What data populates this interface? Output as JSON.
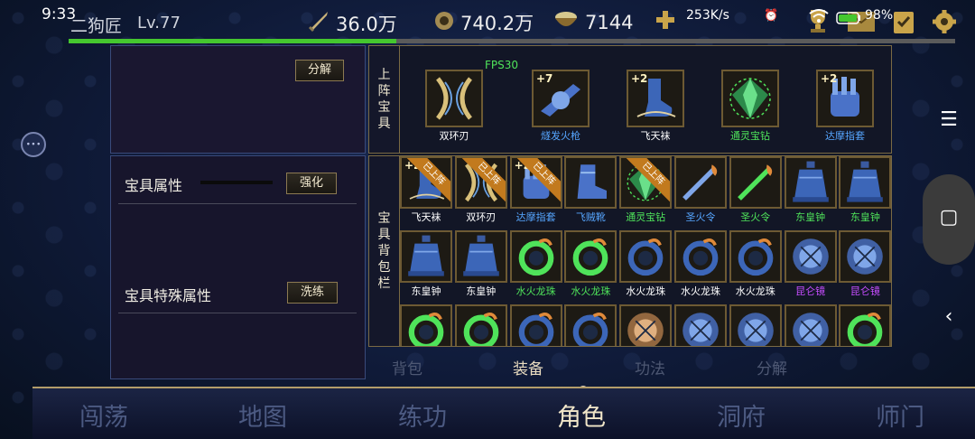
{
  "status": {
    "time": "9:33",
    "network_speed": "253K/s",
    "battery": "98%"
  },
  "player": {
    "name": "二狗匠",
    "level": "Lv.77",
    "xp_fraction": 0.37
  },
  "resources": {
    "power": "36.0万",
    "coins": "740.2万",
    "food": "7144"
  },
  "fps": "FPS30",
  "left": {
    "decompose_btn": "分解",
    "treasure_attr_label": "宝具属性",
    "enhance_btn": "强化",
    "special_attr_label": "宝具特殊属性",
    "refine_btn": "洗练"
  },
  "equipped": {
    "label_chars": [
      "上",
      "阵",
      "宝",
      "具"
    ],
    "items": [
      {
        "name": "双环刃",
        "plus": "",
        "color": "white",
        "icon": "double-ring-blade-icon"
      },
      {
        "name": "燧发火枪",
        "plus": "+7",
        "color": "blue",
        "icon": "flintlock-gun-icon"
      },
      {
        "name": "飞天袜",
        "plus": "+2",
        "color": "white",
        "icon": "flying-sock-icon"
      },
      {
        "name": "通灵宝钻",
        "plus": "",
        "color": "green",
        "icon": "spirit-diamond-icon"
      },
      {
        "name": "达摩指套",
        "plus": "+2",
        "color": "blue",
        "icon": "dharma-finger-icon"
      }
    ]
  },
  "bag": {
    "label_chars": [
      "宝",
      "具",
      "背",
      "包",
      "栏"
    ],
    "equipped_tag": "已上阵",
    "rows": [
      [
        {
          "name": "飞天袜",
          "plus": "+2",
          "tag": true,
          "color": "white",
          "icon": "flying-sock-icon"
        },
        {
          "name": "双环刃",
          "plus": "",
          "tag": true,
          "color": "white",
          "icon": "double-ring-blade-icon"
        },
        {
          "name": "达摩指套",
          "plus": "+2",
          "tag": true,
          "color": "blue",
          "icon": "dharma-finger-icon"
        },
        {
          "name": "飞贼靴",
          "plus": "",
          "tag": false,
          "color": "blue",
          "icon": "thief-boots-icon"
        },
        {
          "name": "通灵宝钻",
          "plus": "",
          "tag": true,
          "color": "green",
          "icon": "spirit-diamond-icon"
        },
        {
          "name": "圣火令",
          "plus": "",
          "tag": false,
          "color": "blue",
          "icon": "holy-fire-token-icon"
        },
        {
          "name": "圣火令",
          "plus": "",
          "tag": false,
          "color": "green",
          "icon": "holy-fire-token-icon"
        },
        {
          "name": "东皇钟",
          "plus": "",
          "tag": false,
          "color": "green",
          "icon": "bell-icon"
        },
        {
          "name": "东皇钟",
          "plus": "",
          "tag": false,
          "color": "green",
          "icon": "bell-icon"
        }
      ],
      [
        {
          "name": "东皇钟",
          "plus": "",
          "tag": false,
          "color": "white",
          "icon": "bell-icon"
        },
        {
          "name": "东皇钟",
          "plus": "",
          "tag": false,
          "color": "white",
          "icon": "bell-icon"
        },
        {
          "name": "水火龙珠",
          "plus": "",
          "tag": false,
          "color": "green",
          "icon": "dragon-pearl-icon"
        },
        {
          "name": "水火龙珠",
          "plus": "",
          "tag": false,
          "color": "green",
          "icon": "dragon-pearl-icon"
        },
        {
          "name": "水火龙珠",
          "plus": "",
          "tag": false,
          "color": "white",
          "icon": "dragon-pearl-icon"
        },
        {
          "name": "水火龙珠",
          "plus": "",
          "tag": false,
          "color": "white",
          "icon": "dragon-pearl-icon"
        },
        {
          "name": "水火龙珠",
          "plus": "",
          "tag": false,
          "color": "white",
          "icon": "dragon-pearl-icon"
        },
        {
          "name": "昆仑镜",
          "plus": "",
          "tag": false,
          "color": "purple",
          "icon": "kunlun-mirror-icon"
        },
        {
          "name": "昆仑镜",
          "plus": "",
          "tag": false,
          "color": "purple",
          "icon": "kunlun-mirror-icon"
        }
      ],
      [
        {
          "name": "",
          "plus": "",
          "tag": false,
          "color": "green",
          "icon": "dragon-pearl-icon"
        },
        {
          "name": "",
          "plus": "",
          "tag": false,
          "color": "green",
          "icon": "dragon-pearl-icon"
        },
        {
          "name": "",
          "plus": "",
          "tag": false,
          "color": "blue",
          "icon": "dragon-pearl-icon"
        },
        {
          "name": "",
          "plus": "",
          "tag": false,
          "color": "blue",
          "icon": "dragon-pearl-icon"
        },
        {
          "name": "",
          "plus": "",
          "tag": false,
          "color": "orange",
          "icon": "kunlun-mirror-icon"
        },
        {
          "name": "",
          "plus": "",
          "tag": false,
          "color": "blue",
          "icon": "kunlun-mirror-icon"
        },
        {
          "name": "",
          "plus": "",
          "tag": false,
          "color": "blue",
          "icon": "kunlun-mirror-icon"
        },
        {
          "name": "",
          "plus": "",
          "tag": false,
          "color": "blue",
          "icon": "kunlun-mirror-icon"
        },
        {
          "name": "",
          "plus": "",
          "tag": false,
          "color": "green",
          "icon": "dragon-pearl-icon"
        }
      ]
    ]
  },
  "subtabs": [
    {
      "label": "背包",
      "active": false
    },
    {
      "label": "装备",
      "active": true
    },
    {
      "label": "功法",
      "active": false
    },
    {
      "label": "分解",
      "active": false
    }
  ],
  "nav": [
    {
      "label": "闯荡",
      "active": false
    },
    {
      "label": "地图",
      "active": false
    },
    {
      "label": "练功",
      "active": false
    },
    {
      "label": "角色",
      "active": true
    },
    {
      "label": "洞府",
      "active": false
    },
    {
      "label": "师门",
      "active": false
    }
  ],
  "colors": {
    "white": "#ffffff",
    "blue": "#56a6ff",
    "green": "#4fe35a",
    "purple": "#c64dff",
    "orange": "#ffb050",
    "accent_gold": "#b39d6a",
    "xp_green": "#45c72f"
  }
}
